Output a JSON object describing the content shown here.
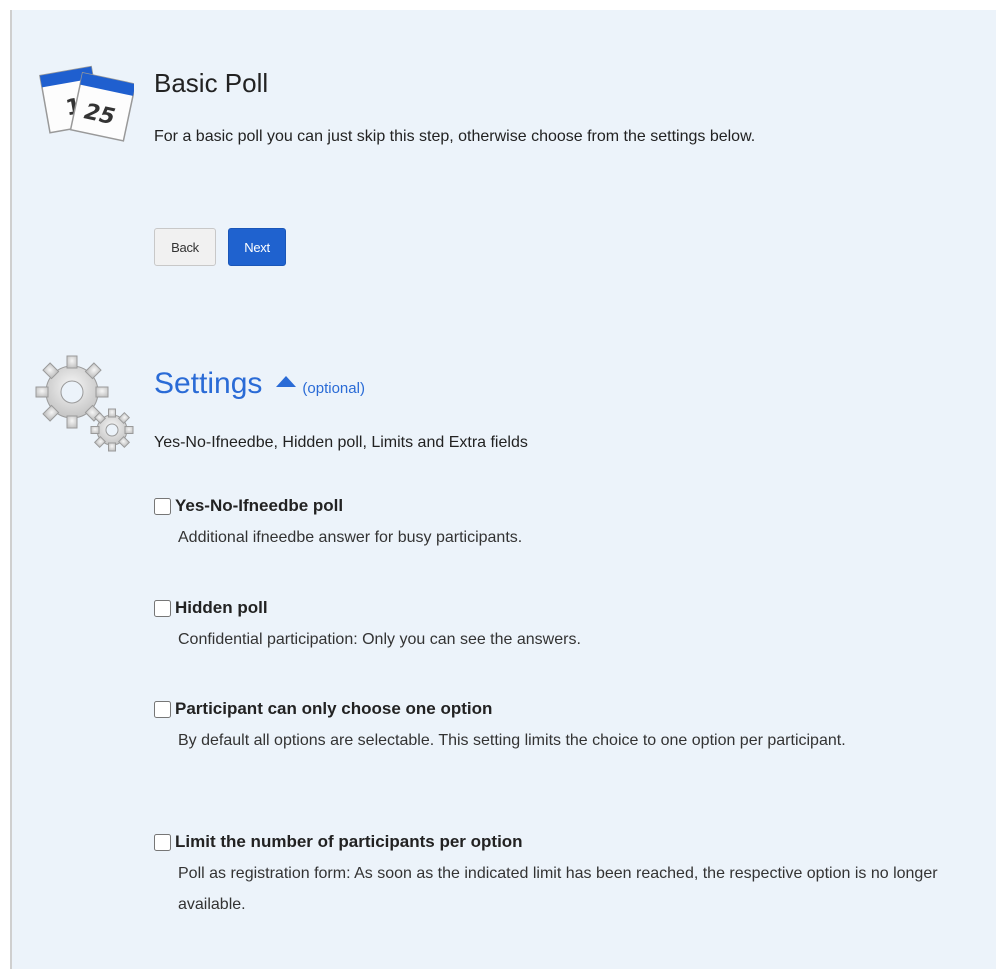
{
  "basic": {
    "title": "Basic Poll",
    "description": "For a basic poll you can just skip this step, otherwise choose from the settings below.",
    "back_label": "Back",
    "next_label": "Next",
    "icon": "calendar-icon",
    "calendar_numbers": [
      "1",
      "25"
    ]
  },
  "settings": {
    "title": "Settings",
    "optional": "(optional)",
    "subtitle": "Yes-No-Ifneedbe, Hidden poll, Limits and Extra fields",
    "icon": "gears-icon",
    "options": [
      {
        "label": "Yes-No-Ifneedbe poll",
        "description": "Additional ifneedbe answer for busy participants.",
        "checked": false
      },
      {
        "label": "Hidden poll",
        "description": "Confidential participation: Only you can see the answers.",
        "checked": false
      },
      {
        "label": "Participant can only choose one option",
        "description": "By default all options are selectable. This setting limits the choice to one option per participant.",
        "checked": false
      },
      {
        "label": "Limit the number of participants per option",
        "description": "Poll as registration form: As soon as the indicated limit has been reached, the respective option is no longer available.",
        "checked": false
      }
    ]
  },
  "colors": {
    "background": "#ecf3fa",
    "accent": "#2a6bd6",
    "primary_button": "#1f62cf"
  }
}
